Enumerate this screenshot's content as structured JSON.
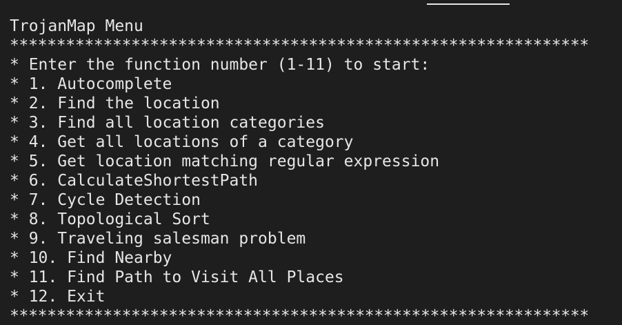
{
  "terminal": {
    "title": "TrojanMap Menu",
    "separator": "**************************************************************",
    "prompt": "* Enter the function number (1-11) to start:",
    "menu_items": [
      "* 1. Autocomplete",
      "* 2. Find the location",
      "* 3. Find all location categories",
      "* 4. Get all locations of a category",
      "* 5. Get location matching regular expression",
      "* 6. CalculateShortestPath",
      "* 7. Cycle Detection",
      "* 8. Topological Sort",
      "* 9. Traveling salesman problem",
      "* 10. Find Nearby",
      "* 11. Find Path to Visit All Places",
      "* 12. Exit"
    ],
    "colors": {
      "background": "#1e1e1e",
      "text": "#e6e6e6"
    }
  }
}
